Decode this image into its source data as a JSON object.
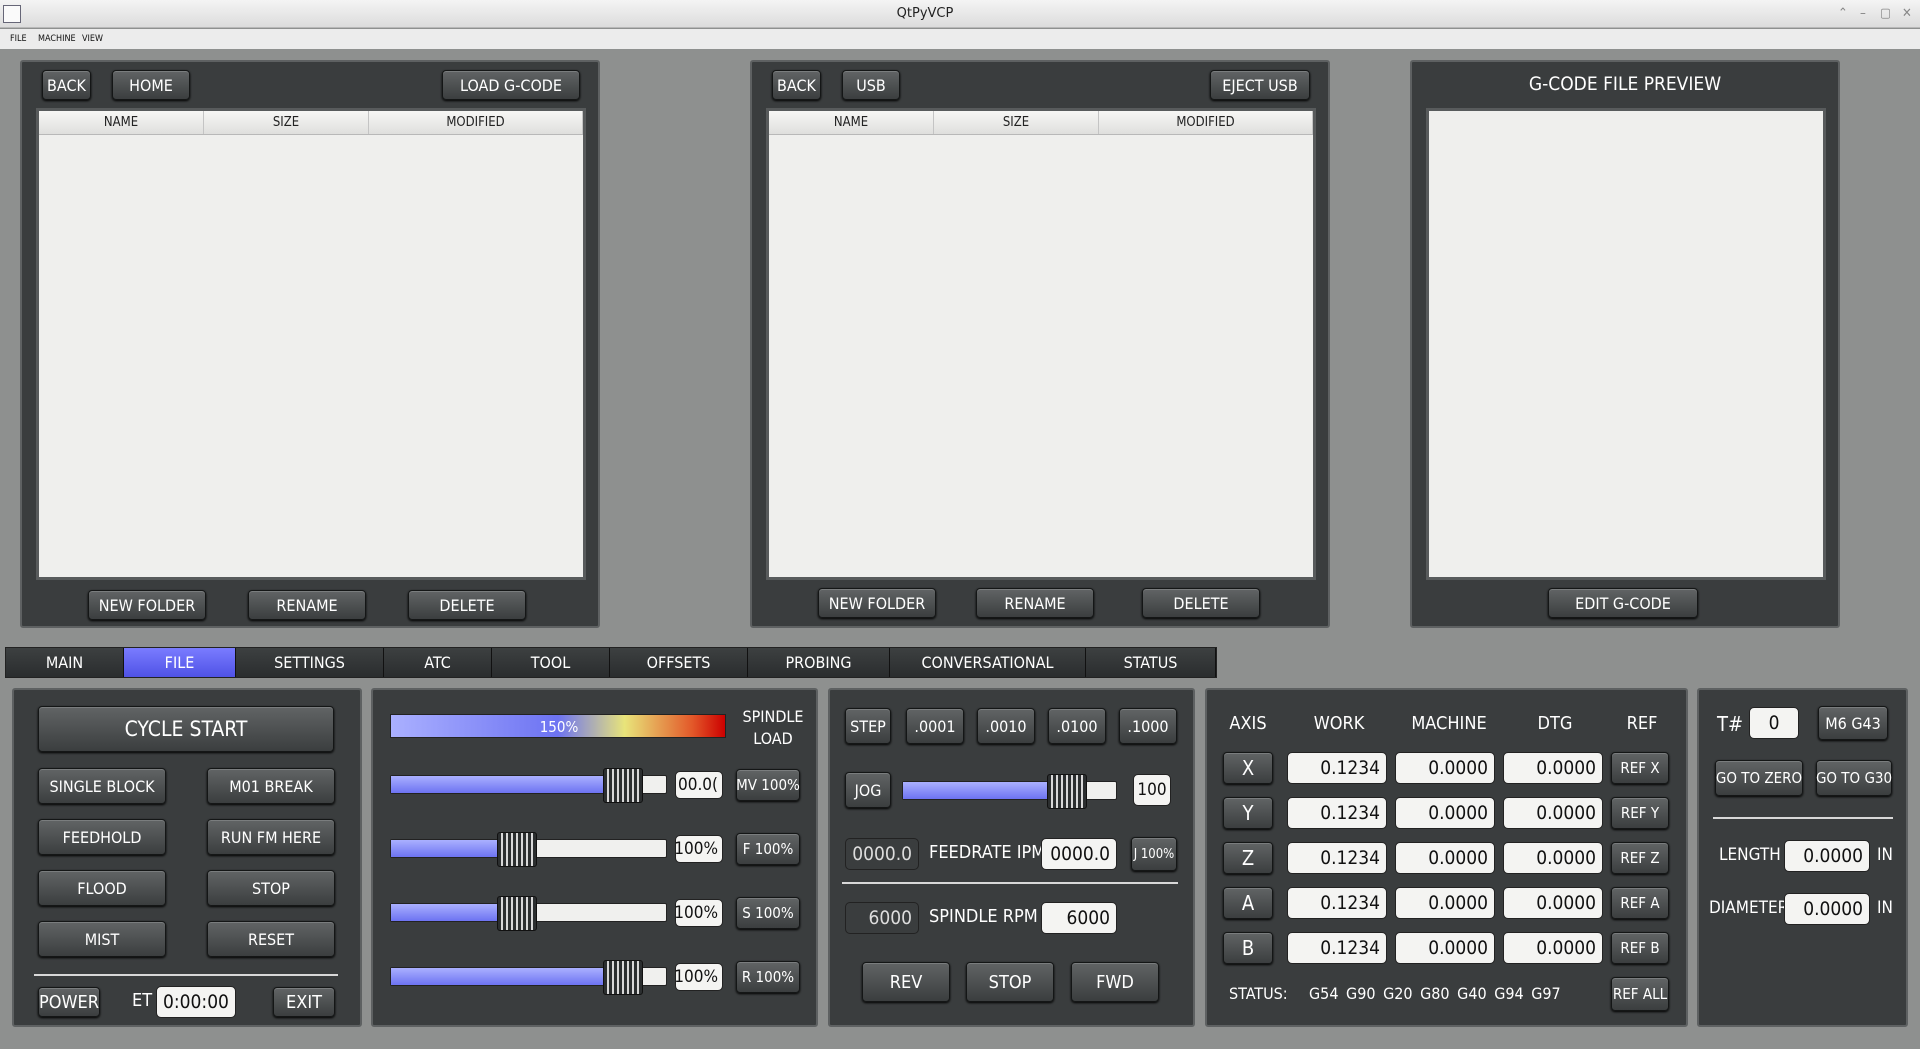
{
  "window": {
    "title": "QtPyVCP"
  },
  "menu": [
    "FILE",
    "MACHINE",
    "VIEW"
  ],
  "browser1": {
    "back": "BACK",
    "home": "HOME",
    "load": "LOAD G-CODE",
    "columns": [
      "NAME",
      "SIZE",
      "MODIFIED"
    ],
    "new_folder": "NEW FOLDER",
    "rename": "RENAME",
    "delete": "DELETE"
  },
  "browser2": {
    "back": "BACK",
    "usb": "USB",
    "eject": "EJECT USB",
    "columns": [
      "NAME",
      "SIZE",
      "MODIFIED"
    ],
    "new_folder": "NEW FOLDER",
    "rename": "RENAME",
    "delete": "DELETE"
  },
  "preview": {
    "title": "G-CODE FILE PREVIEW",
    "edit": "EDIT G-CODE"
  },
  "tabs": [
    {
      "label": "MAIN",
      "active": false
    },
    {
      "label": "FILE",
      "active": true
    },
    {
      "label": "SETTINGS",
      "active": false
    },
    {
      "label": "ATC",
      "active": false
    },
    {
      "label": "TOOL",
      "active": false
    },
    {
      "label": "OFFSETS",
      "active": false
    },
    {
      "label": "PROBING",
      "active": false
    },
    {
      "label": "CONVERSATIONAL",
      "active": false
    },
    {
      "label": "STATUS",
      "active": false
    }
  ],
  "controls": {
    "cycle_start": "CYCLE START",
    "single_block": "SINGLE BLOCK",
    "m01_break": "M01 BREAK",
    "feedhold": "FEEDHOLD",
    "run_fm_here": "RUN FM HERE",
    "flood": "FLOOD",
    "stop": "STOP",
    "mist": "MIST",
    "reset": "RESET",
    "power": "POWER",
    "et_label": "ET",
    "et_value": "0:00:00",
    "exit": "EXIT"
  },
  "overrides": {
    "spindle_load_label": "SPINDLE LOAD",
    "spindle_load_value": "150%",
    "spindle_load_fraction": 0.6,
    "rows": [
      {
        "value": "00.0(",
        "button": "MV 100%",
        "level": 0.9
      },
      {
        "value": "100%",
        "button": "F 100%",
        "level": 0.45
      },
      {
        "value": "100%",
        "button": "S 100%",
        "level": 0.45
      },
      {
        "value": "100%",
        "button": "R 100%",
        "level": 0.9
      }
    ]
  },
  "jog": {
    "step": "STEP",
    "increments": [
      ".0001",
      ".0010",
      ".0100",
      ".1000"
    ],
    "jog": "JOG",
    "jog_value": "100",
    "jog_level": 0.83,
    "feed_actual": "0000.0",
    "feed_label": "FEEDRATE IPM",
    "feed_value": "0000.0",
    "j_btn": "J 100%",
    "rpm_actual": "6000",
    "rpm_label": "SPINDLE RPM",
    "rpm_value": "6000",
    "rev": "REV",
    "stop": "STOP",
    "fwd": "FWD"
  },
  "dro": {
    "headers": [
      "AXIS",
      "WORK",
      "MACHINE",
      "DTG",
      "REF"
    ],
    "axes": [
      {
        "axis": "X",
        "work": "0.1234",
        "machine": "0.0000",
        "dtg": "0.0000",
        "ref": "REF X"
      },
      {
        "axis": "Y",
        "work": "0.1234",
        "machine": "0.0000",
        "dtg": "0.0000",
        "ref": "REF Y"
      },
      {
        "axis": "Z",
        "work": "0.1234",
        "machine": "0.0000",
        "dtg": "0.0000",
        "ref": "REF Z"
      },
      {
        "axis": "A",
        "work": "0.1234",
        "machine": "0.0000",
        "dtg": "0.0000",
        "ref": "REF A"
      },
      {
        "axis": "B",
        "work": "0.1234",
        "machine": "0.0000",
        "dtg": "0.0000",
        "ref": "REF B"
      }
    ],
    "status_label": "STATUS:",
    "gcodes": "G54 G90 G20 G80 G40 G94 G97",
    "ref_all": "REF ALL"
  },
  "tool": {
    "t_label": "T#",
    "t_value": "0",
    "m6g43": "M6 G43",
    "go_zero": "GO TO ZERO",
    "go_g30": "GO TO G30",
    "length_label": "LENGTH",
    "length_value": "0.0000",
    "length_unit": "IN",
    "diameter_label": "DIAMETER",
    "diameter_value": "0.0000",
    "diameter_unit": "IN"
  },
  "colors": {
    "background": "#8e908f",
    "panel": "#3a3d3e",
    "active_tab": "#5a5df0",
    "field": "#f4f4f2"
  }
}
